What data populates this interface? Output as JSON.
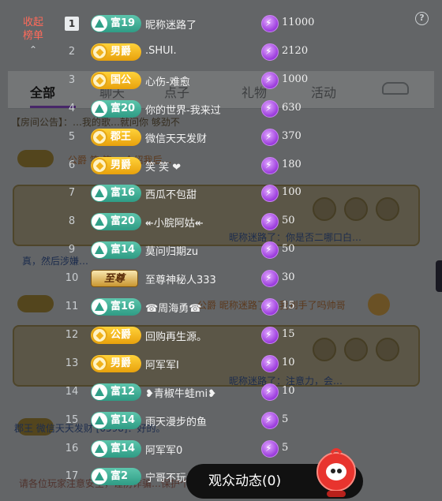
{
  "background": {
    "tabs": [
      "全部",
      "聊天",
      "点子",
      "礼物",
      "活动"
    ],
    "announcement": "【房间公告】：…我的歌…就问你 够劲不",
    "chat_lines": [
      "公爵  笑 笑 ：介绍我后…",
      "昵称迷路了：你是否二哪口白…",
      "真，然后涉嫌…",
      "公爵  昵称迷路了… 我到手了吗帅哥",
      "昵称迷路了：注意力，会…",
      "郡王  微信天天发财 [6598]：好的。"
    ],
    "footer": "请各位玩家注意安全，谨防诈骗…保护个人信息…避免损失。"
  },
  "panel": {
    "collapse_label_1": "收起",
    "collapse_label_2": "榜单",
    "help_icon": "?",
    "rows": [
      {
        "rank": "1",
        "badge": "富19",
        "badge_style": "green",
        "nickname": "昵称迷路了",
        "amount": "11000"
      },
      {
        "rank": "2",
        "badge": "男爵",
        "badge_style": "gold",
        "nickname": ".SHUI.",
        "amount": "2120"
      },
      {
        "rank": "3",
        "badge": "国公",
        "badge_style": "gold",
        "nickname": "心伤-难愈",
        "amount": "1000"
      },
      {
        "rank": "4",
        "badge": "富20",
        "badge_style": "green",
        "nickname": "你的世界-我来过",
        "amount": "630"
      },
      {
        "rank": "5",
        "badge": "郡王",
        "badge_style": "gold",
        "nickname": "微信天天发财",
        "amount": "370"
      },
      {
        "rank": "6",
        "badge": "男爵",
        "badge_style": "gold",
        "nickname": "笑 笑 ❤",
        "amount": "180"
      },
      {
        "rank": "7",
        "badge": "富16",
        "badge_style": "green",
        "nickname": "西瓜不包甜",
        "amount": "100"
      },
      {
        "rank": "8",
        "badge": "富20",
        "badge_style": "green",
        "nickname": "↞小脘阿姑↞",
        "amount": "50"
      },
      {
        "rank": "9",
        "badge": "富14",
        "badge_style": "green",
        "nickname": "莫问归期zu",
        "amount": "50"
      },
      {
        "rank": "10",
        "badge": "至尊",
        "badge_style": "supreme",
        "nickname": "至尊神秘人333",
        "amount": "30"
      },
      {
        "rank": "11",
        "badge": "富16",
        "badge_style": "green",
        "nickname": "☎周海勇☎",
        "amount": "15"
      },
      {
        "rank": "12",
        "badge": "公爵",
        "badge_style": "gold",
        "nickname": "回购再生源。",
        "amount": "15"
      },
      {
        "rank": "13",
        "badge": "男爵",
        "badge_style": "gold",
        "nickname": "阿军军I",
        "amount": "10"
      },
      {
        "rank": "14",
        "badge": "富12",
        "badge_style": "green",
        "nickname": "❥青椒牛蛙mi❥",
        "amount": "10"
      },
      {
        "rank": "15",
        "badge": "富14",
        "badge_style": "green",
        "nickname": "雨天漫步的鱼",
        "amount": "5"
      },
      {
        "rank": "16",
        "badge": "富14",
        "badge_style": "green",
        "nickname": "阿军军0",
        "amount": "5"
      },
      {
        "rank": "17",
        "badge": "富2",
        "badge_style": "green",
        "nickname": "宁哥不玩主来",
        "amount": "5"
      }
    ]
  },
  "audience": {
    "label": "观众动态(0)"
  },
  "colors": {
    "collapse_text": "#ff6a5a",
    "badge_green": "#3fae94",
    "badge_gold": "#f0b21d",
    "coin_purple": "#9a3bdc"
  },
  "icons": {
    "collapse": "chevron-up-icon",
    "help": "question-circle-icon",
    "coin": "lightning-coin-icon",
    "mascot": "mascot-icon"
  }
}
